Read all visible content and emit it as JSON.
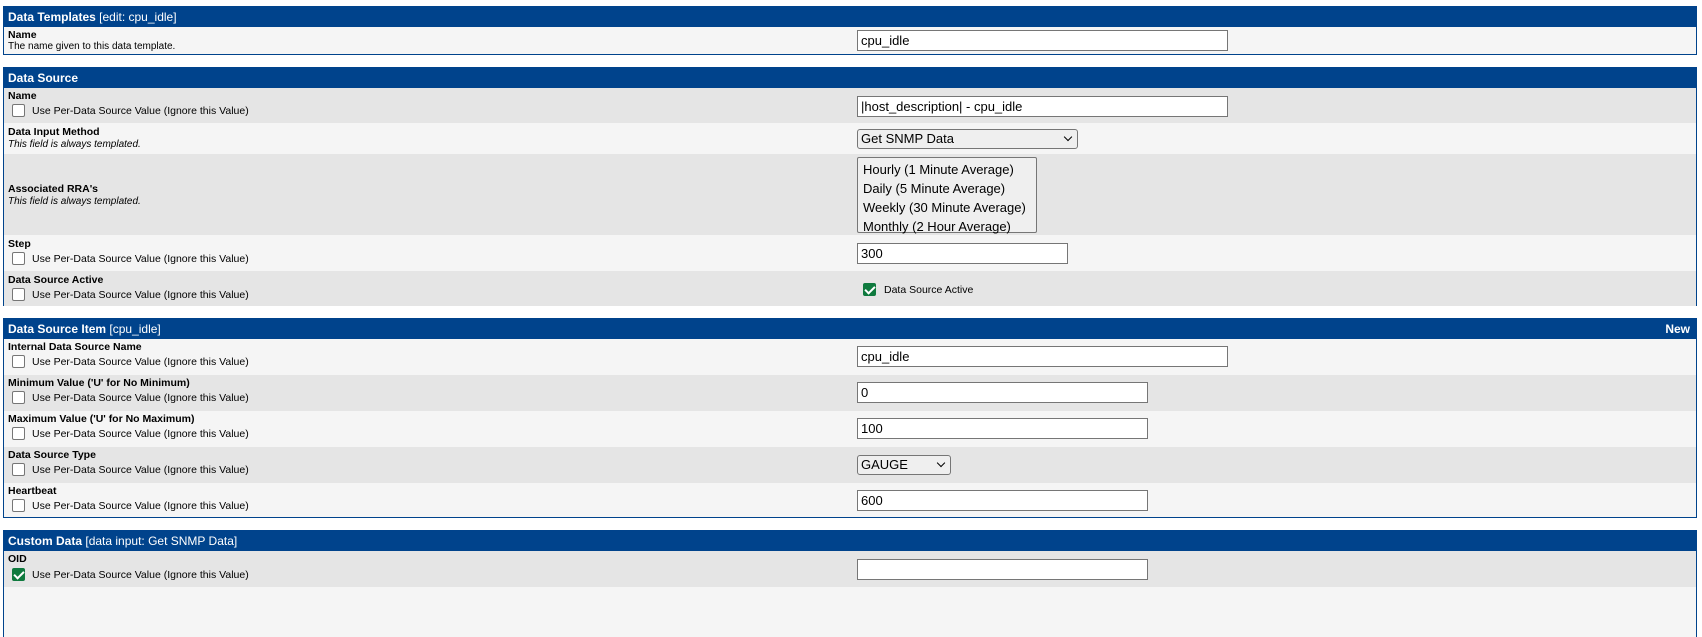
{
  "colors": {
    "header_bg": "#00438c",
    "row_even": "#f5f5f5",
    "row_odd": "#e5e5e5",
    "checkbox_on": "#0f7a3e"
  },
  "per_source_label": "Use Per-Data Source Value (Ignore this Value)",
  "always_templated": "This field is always templated.",
  "template": {
    "title": "Data Templates",
    "subtitle": "[edit: cpu_idle]",
    "name_label": "Name",
    "name_desc": "The name given to this data template.",
    "name_value": "cpu_idle"
  },
  "data_source": {
    "title": "Data Source",
    "name_label": "Name",
    "name_value": "|host_description| - cpu_idle",
    "input_method_label": "Data Input Method",
    "input_method_value": "Get SNMP Data",
    "rra_label": "Associated RRA's",
    "rra_options": [
      "Hourly (1 Minute Average)",
      "Daily (5 Minute Average)",
      "Weekly (30 Minute Average)",
      "Monthly (2 Hour Average)"
    ],
    "step_label": "Step",
    "step_value": "300",
    "active_label": "Data Source Active",
    "active_checkbox_label": "Data Source Active"
  },
  "item": {
    "title": "Data Source Item",
    "subtitle": "[cpu_idle]",
    "new_label": "New",
    "internal_name_label": "Internal Data Source Name",
    "internal_name_value": "cpu_idle",
    "min_label": "Minimum Value ('U' for No Minimum)",
    "min_value": "0",
    "max_label": "Maximum Value ('U' for No Maximum)",
    "max_value": "100",
    "type_label": "Data Source Type",
    "type_value": "GAUGE",
    "heartbeat_label": "Heartbeat",
    "heartbeat_value": "600"
  },
  "custom": {
    "title": "Custom Data",
    "subtitle": "[data input: Get SNMP Data]",
    "oid_label": "OID",
    "oid_value": ""
  }
}
